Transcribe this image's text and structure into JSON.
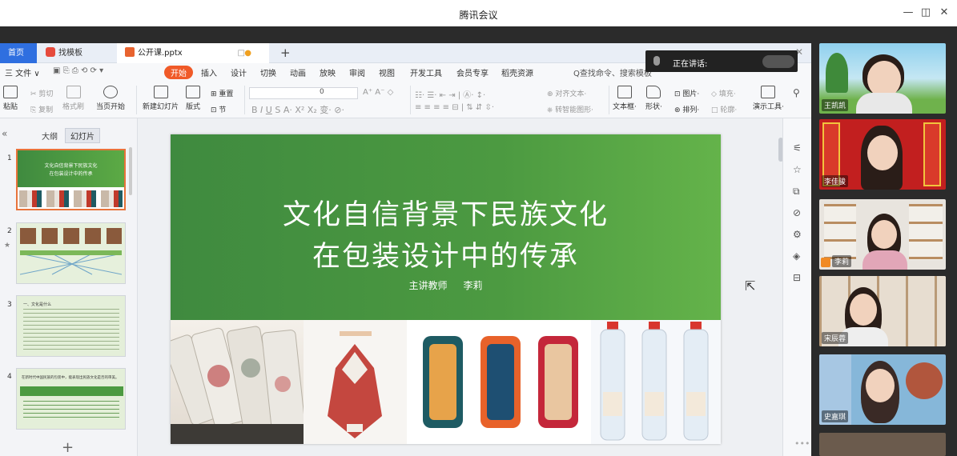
{
  "window": {
    "title": "腾讯会议",
    "controls": {
      "minimize": "—",
      "maximize": "◫",
      "close": "✕"
    }
  },
  "tabs": {
    "home": "首页",
    "templates": "找模板",
    "file": "公开课.pptx",
    "new": "+"
  },
  "menu": {
    "items": [
      "三 文件 ∨",
      "开始",
      "插入",
      "设计",
      "切换",
      "动画",
      "放映",
      "审阅",
      "视图",
      "开发工具",
      "会员专享",
      "稻壳资源"
    ],
    "search": "Q查找命令、搜索模板"
  },
  "ribbon": {
    "paste": "粘贴",
    "cut": "剪切",
    "copy": "复制",
    "format_painter": "格式刷",
    "from_current": "当页开始",
    "new_slide": "新建幻灯片",
    "layout": "版式",
    "section": "节",
    "reset": "重置",
    "font_size": "0",
    "align_text": "对齐文本",
    "smart_shape": "转智能图形",
    "textbox": "文本框",
    "shape": "形状",
    "picture": "图片",
    "fill": "填充",
    "arrange": "排列",
    "outline": "轮廓",
    "present_tools": "演示工具"
  },
  "panel": {
    "collapse": "«",
    "tab_outline": "大纲",
    "tab_slides": "幻灯片",
    "add": "+",
    "thumbs": [
      {
        "num": "1",
        "title1": "文化自信背景下民族文化",
        "title2": "在包装设计中的传承"
      },
      {
        "num": "2"
      },
      {
        "num": "3",
        "title": "一、文化是什么"
      },
      {
        "num": "4",
        "title": "在新时代中国民族的包装中，能表现出民族文化是否的审美。"
      }
    ]
  },
  "slide": {
    "title_line1": "文化自信背景下民族文化",
    "title_line2": "在包装设计中的传承",
    "presenter_label": "主讲教师",
    "presenter_name": "李莉"
  },
  "speaking": {
    "label": "正在讲话:"
  },
  "participants": [
    {
      "name": "王凯凯"
    },
    {
      "name": "李佳骏"
    },
    {
      "name": "李莉"
    },
    {
      "name": "宋辰蓉"
    },
    {
      "name": "史嘉琪"
    }
  ],
  "colors": {
    "accent": "#2f6fe0",
    "start_tab": "#f05a28",
    "slide_green": "#4c9a41",
    "dark_bg": "#2b2b2b"
  }
}
